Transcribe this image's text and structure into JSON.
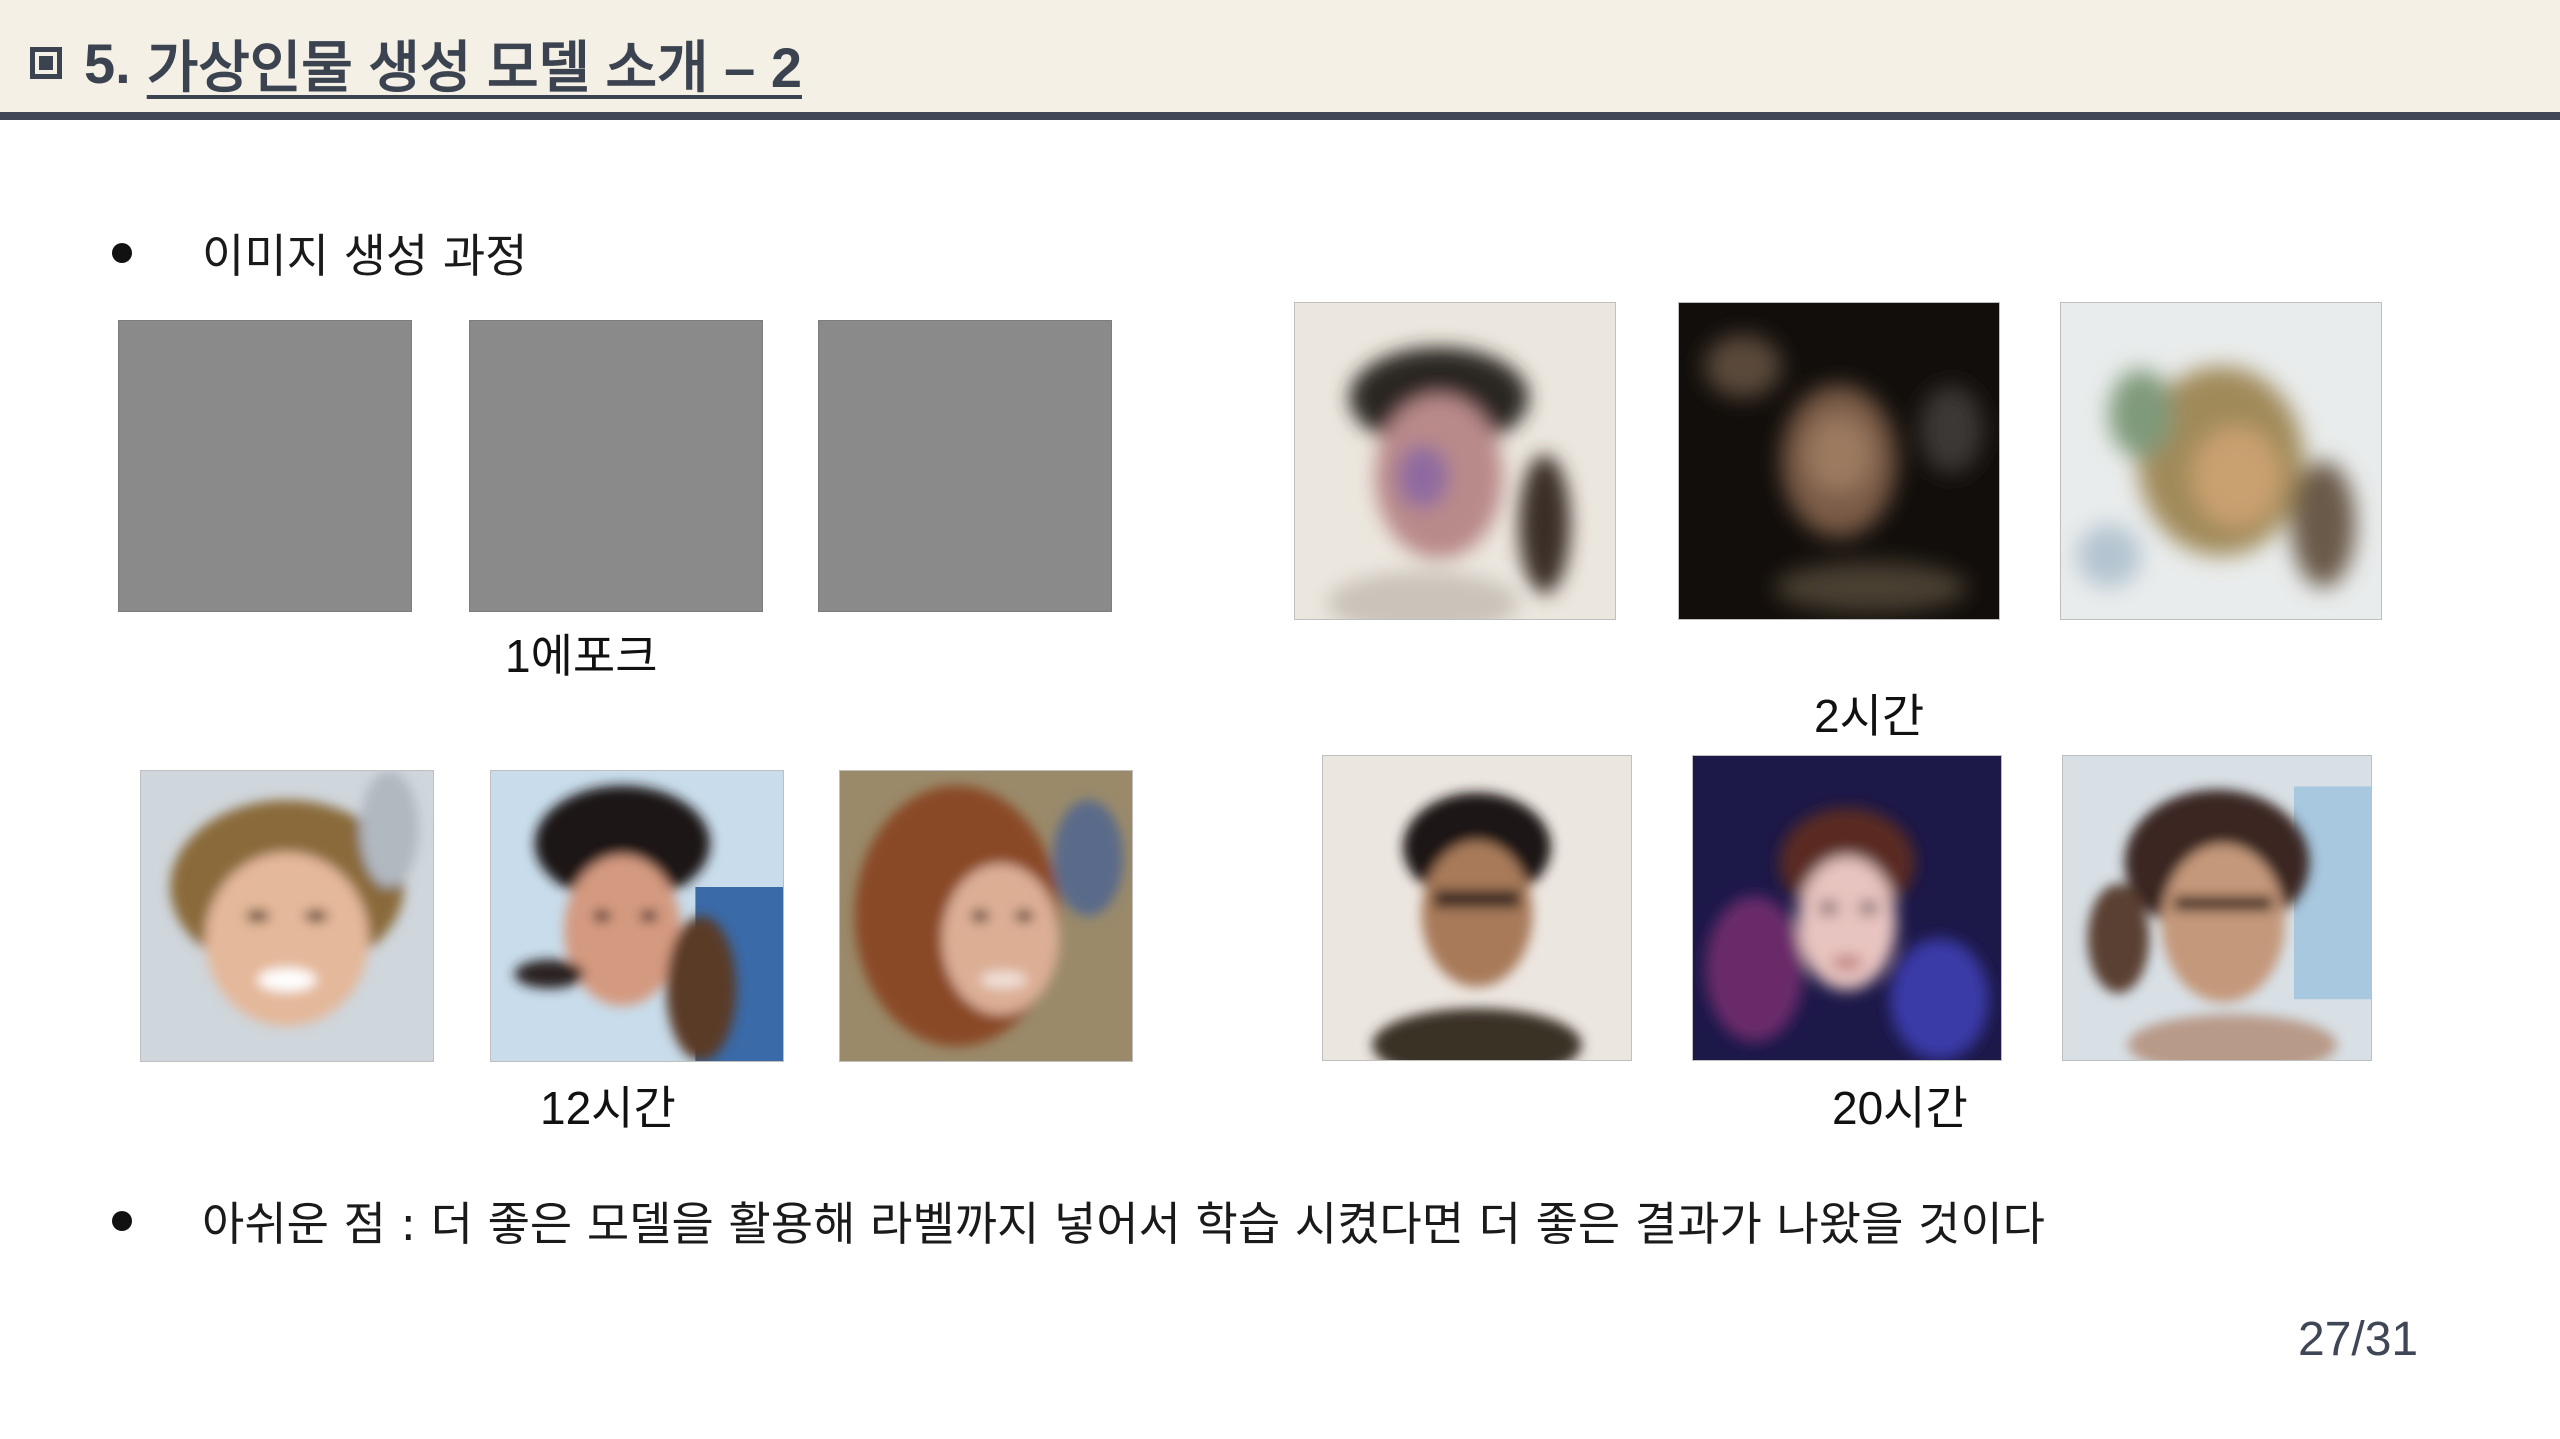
{
  "slide": {
    "section_number": "5.",
    "title": "가상인물 생성 모델 소개 – 2",
    "bullets": [
      {
        "text": "이미지 생성 과정"
      },
      {
        "text": "아쉬운 점 : 더 좋은 모델을 활용해 라벨까지 넣어서 학습 시켰다면 더 좋은 결과가 나왔을 것이다"
      }
    ],
    "captions": {
      "epoch1": "1에포크",
      "hours2": "2시간",
      "hours12": "12시간",
      "hours20": "20시간"
    },
    "page_number": "27/31"
  },
  "images": {
    "epoch1": [
      "gray-noise-image",
      "gray-noise-image",
      "gray-noise-image"
    ],
    "hours2": [
      "blurry-face-image",
      "dark-blurry-face-image",
      "faint-blurry-face-image"
    ],
    "hours12": [
      "smiling-woman-face-image",
      "dark-haired-face-image",
      "long-haired-woman-face-image"
    ],
    "hours20": [
      "man-with-glasses-face-image",
      "woman-face-dark-blue-background-image",
      "face-with-glasses-image"
    ]
  },
  "colors": {
    "header_background": "#f4f0e6",
    "header_rule": "#3f4756",
    "title_color": "#3c4350",
    "placeholder_gray": "#8a8a8a"
  }
}
